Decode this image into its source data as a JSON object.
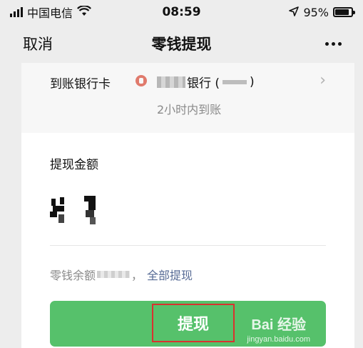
{
  "status_bar": {
    "carrier": "中国电信",
    "time": "08:59",
    "battery_percent": "95%",
    "battery_level": 0.95
  },
  "nav": {
    "cancel_label": "取消",
    "title": "零钱提现"
  },
  "bank": {
    "label": "到账银行卡",
    "name_suffix": "银行 (",
    "name_close": ")",
    "arrival_time": "2小时内到账"
  },
  "amount": {
    "title": "提现金额"
  },
  "balance": {
    "prefix": "零钱余额",
    "separator": "，",
    "withdraw_all": "全部提现"
  },
  "button": {
    "label": "提现"
  },
  "watermark": {
    "text": "Bai 经验",
    "sub": "jingyan.baidu.com"
  },
  "colors": {
    "primary_green": "#56c16b",
    "link_blue": "#576b95",
    "highlight_red": "#d9322f"
  }
}
